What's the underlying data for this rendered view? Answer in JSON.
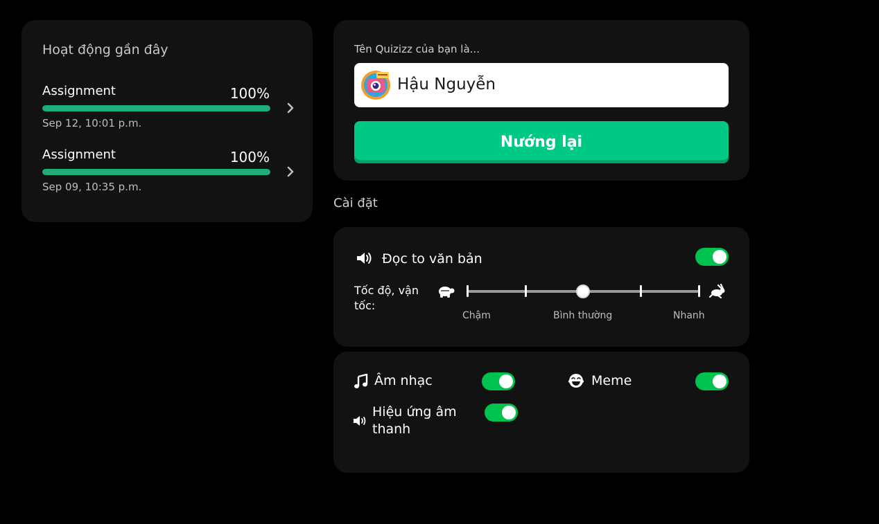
{
  "recent_activity": {
    "title": "Hoạt động gần đây",
    "items": [
      {
        "label": "Assignment",
        "percent": "100%",
        "progress": 1.0,
        "date": "Sep 12, 10:01 p.m."
      },
      {
        "label": "Assignment",
        "percent": "100%",
        "progress": 1.0,
        "date": "Sep 09, 10:35 p.m."
      }
    ]
  },
  "name_card": {
    "label": "Tên Quizizz của bạn là...",
    "name": "Hậu Nguyễn",
    "reroll_button": "Nướng lại"
  },
  "settings": {
    "title": "Cài đặt",
    "read_aloud": {
      "label": "Đọc to văn bản",
      "enabled": true,
      "speed_label": "Tốc độ, vận tốc:",
      "speed_options": [
        "Chậm",
        "Bình thường",
        "Nhanh"
      ],
      "speed_selected": "Bình thường"
    },
    "music": {
      "label": "Âm nhạc",
      "enabled": true
    },
    "meme": {
      "label": "Meme",
      "enabled": true
    },
    "sound_effects": {
      "label": "Hiệu ứng âm thanh",
      "enabled": true
    }
  },
  "colors": {
    "progress": "#1fad7a",
    "primary_button": "#00c985",
    "toggle_on": "#00c24e"
  }
}
